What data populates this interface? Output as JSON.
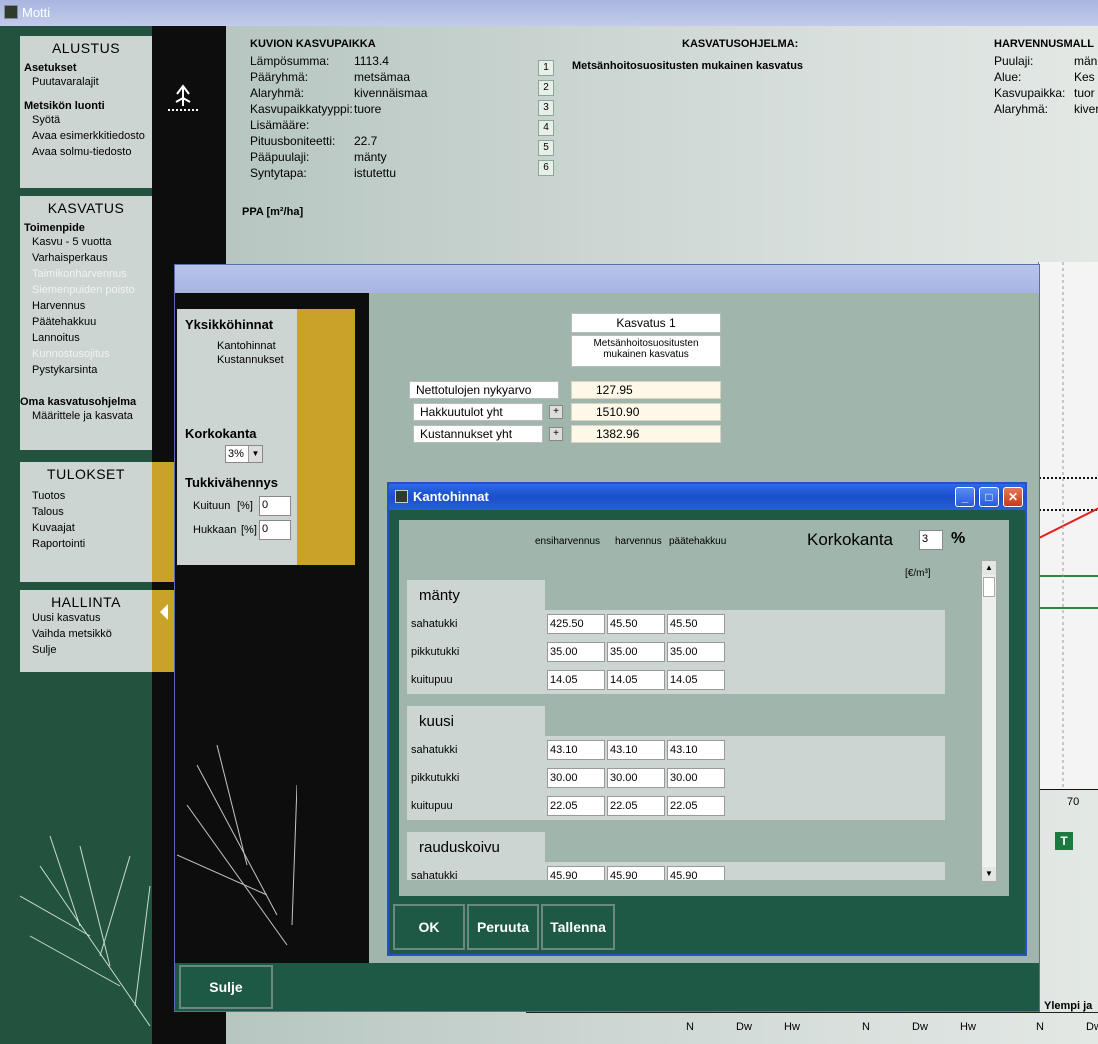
{
  "window": {
    "title": "Motti"
  },
  "sidebar": {
    "alustus": {
      "header": "ALUSTUS",
      "groups": [
        {
          "title": "Asetukset",
          "items": [
            "Puutavaralajit"
          ]
        },
        {
          "title": "Metsikön luonti",
          "items": [
            "Syötä",
            "Avaa esimerkkitiedosto",
            "Avaa solmu-tiedosto"
          ]
        }
      ]
    },
    "kasvatus": {
      "header": "KASVATUS",
      "group_title": "Toimenpide",
      "items": [
        "Kasvu - 5 vuotta",
        "Varhaisperkaus",
        "Taimikonharvennus",
        "Siemenpuiden poisto",
        "Harvennus",
        "Päätehakkuu",
        "Lannoitus",
        "Kunnostusojitus",
        "Pystykarsinta"
      ],
      "group2_title": "Oma kasvatusohjelma",
      "group2_items": [
        "Määrittele ja kasvata"
      ]
    },
    "tulokset": {
      "header": "TULOKSET",
      "items": [
        "Tuotos",
        "Talous",
        "Kuvaajat",
        "Raportointi"
      ]
    },
    "hallinta": {
      "header": "HALLINTA",
      "items": [
        "Uusi kasvatus",
        "Vaihda metsikkö",
        "Sulje"
      ]
    }
  },
  "site": {
    "title": "KUVION KASVUPAIKKA",
    "fields": [
      {
        "label": "Lämpösumma:",
        "value": "1113.4"
      },
      {
        "label": "Pääryhmä:",
        "value": "metsämaa"
      },
      {
        "label": "Alaryhmä:",
        "value": "kivennäismaa"
      },
      {
        "label": "Kasvupaikkatyyppi:",
        "value": "tuore"
      },
      {
        "label": "Lisämääre:",
        "value": ""
      },
      {
        "label": "Pituusboniteetti:",
        "value": "22.7"
      },
      {
        "label": "Pääpuulaji:",
        "value": "mänty"
      },
      {
        "label": "Syntytapa:",
        "value": "istutettu"
      }
    ],
    "num_buttons": [
      "1",
      "2",
      "3",
      "4",
      "5",
      "6"
    ]
  },
  "program": {
    "title": "KASVATUSOHJELMA:",
    "value": "Metsänhoitosuositusten mukainen kasvatus"
  },
  "thinning_model": {
    "title": "HARVENNUSMALL",
    "fields": [
      {
        "label": "Puulaji:",
        "value": "män"
      },
      {
        "label": "Alue:",
        "value": "Kes"
      },
      {
        "label": "Kasvupaikka:",
        "value": "tuor"
      },
      {
        "label": "Alaryhmä:",
        "value": "kiver"
      }
    ]
  },
  "ppa_label": "PPA [m²/ha]",
  "chart": {
    "tick": "70",
    "badge": "T"
  },
  "bottom": {
    "header": "Ylempi ja",
    "axis_labels": [
      "N",
      "Dw",
      "Hw",
      "N",
      "Dw",
      "Hw",
      "N",
      "Dw"
    ]
  },
  "midwin": {
    "yksikkohinnat": {
      "title": "Yksikköhinnat",
      "items": [
        "Kantohinnat",
        "Kustannukset"
      ]
    },
    "korkokanta": {
      "title": "Korkokanta",
      "value": "3%"
    },
    "tukkivahennys": {
      "title": "Tukkivähennys",
      "kuituun_label": "Kuituun",
      "hukkaan_label": "Hukkaan",
      "unit": "[%]",
      "kuituun_value": "0",
      "hukkaan_value": "0"
    },
    "kasvatus_title": "Kasvatus 1",
    "kasvatus_desc": "Metsänhoitosuositusten mukainen kasvatus",
    "summary": [
      {
        "label": "Nettotulojen nykyarvo",
        "value": "127.95",
        "plus": false
      },
      {
        "label": "Hakkuutulot yht",
        "value": "1510.90",
        "plus": true
      },
      {
        "label": "Kustannukset yht",
        "value": "1382.96",
        "plus": true
      }
    ],
    "close_label": "Sulje"
  },
  "dialog": {
    "title": "Kantohinnat",
    "columns": [
      "ensiharvennus",
      "harvennus",
      "päätehakkuu"
    ],
    "korkokanta_label": "Korkokanta",
    "korkokanta_value": "3",
    "percent": "%",
    "unit": "[€/m³]",
    "species": [
      {
        "name": "mänty",
        "rows": [
          {
            "label": "sahatukki",
            "values": [
              "425.50",
              "45.50",
              "45.50"
            ]
          },
          {
            "label": "pikkutukki",
            "values": [
              "35.00",
              "35.00",
              "35.00"
            ]
          },
          {
            "label": "kuitupuu",
            "values": [
              "14.05",
              "14.05",
              "14.05"
            ]
          }
        ]
      },
      {
        "name": "kuusi",
        "rows": [
          {
            "label": "sahatukki",
            "values": [
              "43.10",
              "43.10",
              "43.10"
            ]
          },
          {
            "label": "pikkutukki",
            "values": [
              "30.00",
              "30.00",
              "30.00"
            ]
          },
          {
            "label": "kuitupuu",
            "values": [
              "22.05",
              "22.05",
              "22.05"
            ]
          }
        ]
      },
      {
        "name": "rauduskoivu",
        "rows": [
          {
            "label": "sahatukki",
            "values": [
              "45.90",
              "45.90",
              "45.90"
            ]
          }
        ]
      }
    ],
    "buttons": {
      "ok": "OK",
      "cancel": "Peruuta",
      "save": "Tallenna"
    }
  },
  "colors": {
    "sidebar_green": "#22533f",
    "accent_gold": "#c9a227",
    "dialog_blue": "#2552c8"
  }
}
